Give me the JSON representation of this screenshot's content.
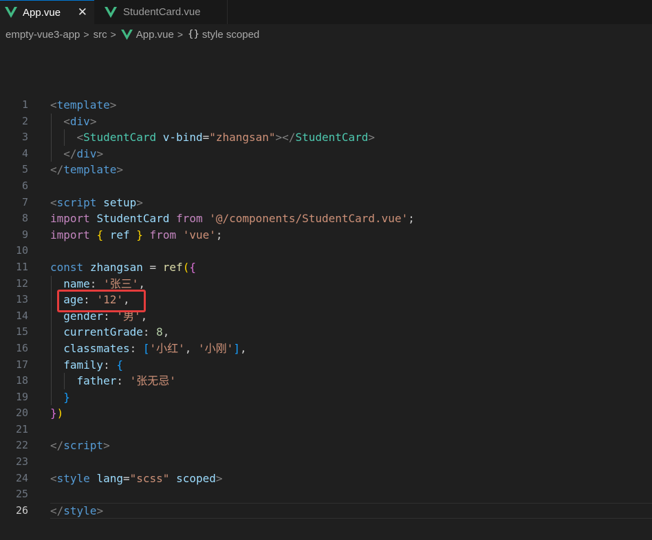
{
  "tabs": [
    {
      "label": "App.vue",
      "active": true,
      "close": "✕"
    },
    {
      "label": "StudentCard.vue",
      "active": false
    }
  ],
  "breadcrumb": {
    "items": [
      "empty-vue3-app",
      "src",
      "App.vue",
      "style scoped"
    ],
    "separator": ">",
    "braces": "{}"
  },
  "colors": {
    "accent": "#0078d4",
    "vue_green": "#41b883",
    "highlight": "#e53c3c"
  },
  "editor": {
    "current_line": 26,
    "lines": [
      {
        "n": "1",
        "tokens": [
          [
            "t-angle",
            "<"
          ],
          [
            "t-tag",
            "template"
          ],
          [
            "t-angle",
            ">"
          ]
        ]
      },
      {
        "n": "2",
        "tokens": [
          [
            "",
            "  "
          ],
          [
            "t-angle",
            "<"
          ],
          [
            "t-tag",
            "div"
          ],
          [
            "t-angle",
            ">"
          ]
        ]
      },
      {
        "n": "3",
        "tokens": [
          [
            "",
            "    "
          ],
          [
            "t-angle",
            "<"
          ],
          [
            "t-comp",
            "StudentCard"
          ],
          [
            "t-punct",
            " "
          ],
          [
            "t-attr",
            "v-bind"
          ],
          [
            "t-punct",
            "="
          ],
          [
            "t-str",
            "\"zhangsan\""
          ],
          [
            "t-angle",
            "></"
          ],
          [
            "t-comp",
            "StudentCard"
          ],
          [
            "t-angle",
            ">"
          ]
        ]
      },
      {
        "n": "4",
        "tokens": [
          [
            "",
            "  "
          ],
          [
            "t-angle",
            "</"
          ],
          [
            "t-tag",
            "div"
          ],
          [
            "t-angle",
            ">"
          ]
        ]
      },
      {
        "n": "5",
        "tokens": [
          [
            "t-angle",
            "</"
          ],
          [
            "t-tag",
            "template"
          ],
          [
            "t-angle",
            ">"
          ]
        ]
      },
      {
        "n": "6",
        "tokens": []
      },
      {
        "n": "7",
        "tokens": [
          [
            "t-angle",
            "<"
          ],
          [
            "t-tag",
            "script"
          ],
          [
            "t-punct",
            " "
          ],
          [
            "t-attr",
            "setup"
          ],
          [
            "t-angle",
            ">"
          ]
        ]
      },
      {
        "n": "8",
        "tokens": [
          [
            "t-kw",
            "import"
          ],
          [
            "t-punct",
            " "
          ],
          [
            "t-var",
            "StudentCard"
          ],
          [
            "t-punct",
            " "
          ],
          [
            "t-kw",
            "from"
          ],
          [
            "t-punct",
            " "
          ],
          [
            "t-str",
            "'@/components/StudentCard.vue'"
          ],
          [
            "t-punct",
            ";"
          ]
        ]
      },
      {
        "n": "9",
        "tokens": [
          [
            "t-kw",
            "import"
          ],
          [
            "t-punct",
            " "
          ],
          [
            "t-b1",
            "{"
          ],
          [
            "t-punct",
            " "
          ],
          [
            "t-var",
            "ref"
          ],
          [
            "t-punct",
            " "
          ],
          [
            "t-b1",
            "}"
          ],
          [
            "t-punct",
            " "
          ],
          [
            "t-kw",
            "from"
          ],
          [
            "t-punct",
            " "
          ],
          [
            "t-str",
            "'vue'"
          ],
          [
            "t-punct",
            ";"
          ]
        ]
      },
      {
        "n": "10",
        "tokens": []
      },
      {
        "n": "11",
        "tokens": [
          [
            "t-kw2",
            "const"
          ],
          [
            "t-punct",
            " "
          ],
          [
            "t-var",
            "zhangsan"
          ],
          [
            "t-punct",
            " = "
          ],
          [
            "t-fn",
            "ref"
          ],
          [
            "t-b1",
            "("
          ],
          [
            "t-b2",
            "{"
          ]
        ]
      },
      {
        "n": "12",
        "tokens": [
          [
            "",
            "  "
          ],
          [
            "t-var",
            "name"
          ],
          [
            "t-punct",
            ": "
          ],
          [
            "t-str",
            "'张三'"
          ],
          [
            "t-punct",
            ","
          ]
        ]
      },
      {
        "n": "13",
        "tokens": [
          [
            "",
            "  "
          ],
          [
            "t-var",
            "age"
          ],
          [
            "t-punct",
            ": "
          ],
          [
            "t-str",
            "'12'"
          ],
          [
            "t-punct",
            ","
          ]
        ]
      },
      {
        "n": "14",
        "tokens": [
          [
            "",
            "  "
          ],
          [
            "t-var",
            "gender"
          ],
          [
            "t-punct",
            ": "
          ],
          [
            "t-str",
            "'男'"
          ],
          [
            "t-punct",
            ","
          ]
        ]
      },
      {
        "n": "15",
        "tokens": [
          [
            "",
            "  "
          ],
          [
            "t-var",
            "currentGrade"
          ],
          [
            "t-punct",
            ": "
          ],
          [
            "t-num",
            "8"
          ],
          [
            "t-punct",
            ","
          ]
        ]
      },
      {
        "n": "16",
        "tokens": [
          [
            "",
            "  "
          ],
          [
            "t-var",
            "classmates"
          ],
          [
            "t-punct",
            ": "
          ],
          [
            "t-b3",
            "["
          ],
          [
            "t-str",
            "'小红'"
          ],
          [
            "t-punct",
            ", "
          ],
          [
            "t-str",
            "'小刚'"
          ],
          [
            "t-b3",
            "]"
          ],
          [
            "t-punct",
            ","
          ]
        ]
      },
      {
        "n": "17",
        "tokens": [
          [
            "",
            "  "
          ],
          [
            "t-var",
            "family"
          ],
          [
            "t-punct",
            ": "
          ],
          [
            "t-b3",
            "{"
          ]
        ]
      },
      {
        "n": "18",
        "tokens": [
          [
            "",
            "    "
          ],
          [
            "t-var",
            "father"
          ],
          [
            "t-punct",
            ": "
          ],
          [
            "t-str",
            "'张无忌'"
          ]
        ]
      },
      {
        "n": "19",
        "tokens": [
          [
            "",
            "  "
          ],
          [
            "t-b3",
            "}"
          ]
        ]
      },
      {
        "n": "20",
        "tokens": [
          [
            "t-b2",
            "}"
          ],
          [
            "t-b1",
            ")"
          ]
        ]
      },
      {
        "n": "21",
        "tokens": []
      },
      {
        "n": "22",
        "tokens": [
          [
            "t-angle",
            "</"
          ],
          [
            "t-tag",
            "script"
          ],
          [
            "t-angle",
            ">"
          ]
        ]
      },
      {
        "n": "23",
        "tokens": []
      },
      {
        "n": "24",
        "tokens": [
          [
            "t-angle",
            "<"
          ],
          [
            "t-tag",
            "style"
          ],
          [
            "t-punct",
            " "
          ],
          [
            "t-attr",
            "lang"
          ],
          [
            "t-punct",
            "="
          ],
          [
            "t-str",
            "\"scss\""
          ],
          [
            "t-punct",
            " "
          ],
          [
            "t-attr",
            "scoped"
          ],
          [
            "t-angle",
            ">"
          ]
        ]
      },
      {
        "n": "25",
        "tokens": []
      },
      {
        "n": "26",
        "tokens": [
          [
            "t-angle",
            "</"
          ],
          [
            "t-tag",
            "style"
          ],
          [
            "t-angle",
            ">"
          ]
        ]
      }
    ]
  }
}
